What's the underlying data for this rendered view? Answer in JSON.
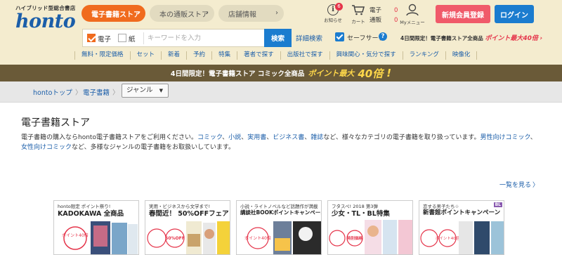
{
  "header": {
    "logo_tagline": "ハイブリッド型総合書店",
    "logo_word": "honto",
    "nav": [
      {
        "label": "電子書籍ストア"
      },
      {
        "label": "本の通販ストア"
      },
      {
        "label": "店舗情報"
      }
    ],
    "info": {
      "label": "お知らせ",
      "badge": "6"
    },
    "cart": {
      "label": "カート",
      "ebook_label": "電子",
      "ebook_count": "0",
      "paper_label": "通販",
      "paper_count": "0"
    },
    "my_menu_label": "Myメニュー",
    "register_label": "新規会員登録",
    "login_label": "ログイン"
  },
  "search": {
    "ebook_label": "電子",
    "paper_label": "紙",
    "placeholder": "キーワードを入力",
    "button_label": "検索",
    "advanced_label": "詳細検索",
    "safe_search_label": "セーフサーチ",
    "help_label": "?",
    "promo_text": "4日間限定！電子書籍ストア全商品",
    "promo_highlight": "ポイント最大40倍"
  },
  "subnav": [
    "無料・限定価格",
    "セット",
    "新着",
    "予約",
    "特集",
    "著者で探す",
    "出版社で探す",
    "興味関心・気分で探す",
    "ランキング",
    "映像化"
  ],
  "banner": {
    "text": "4日間限定！電子書籍ストア コミック全商品",
    "highlight": "ポイント最大",
    "big": "40倍",
    "end": "!"
  },
  "breadcrumb": {
    "home": "hontoトップ",
    "ebook": "電子書籍",
    "genre_select": "ジャンル",
    "sep": "〉"
  },
  "main": {
    "title": "電子書籍ストア",
    "intro": {
      "p1": "電子書籍の購入ならhonto電子書籍ストアをご利用ください。",
      "l1": "コミック",
      "c1": "、",
      "l2": "小説",
      "c2": "、",
      "l3": "実用書",
      "c3": "、",
      "l4": "ビジネス書",
      "c4": "、",
      "l5": "雑誌",
      "p2": "など、様々なカテゴリの電子書籍を取り扱っています。",
      "l6": "男性向けコミック",
      "c5": "、",
      "l7": "女性向けコミック",
      "p3": "など、多様なジャンルの電子書籍をお取扱いしています。"
    },
    "see_all_label": "一覧を見る",
    "see_all_chev": "〉"
  },
  "cards": [
    {
      "sub": "honto限定 ポイント祭り!",
      "title": "KADOKAWA 全商品",
      "badge": "ポイント40倍"
    },
    {
      "sub": "実用・ビジネスから文学まで!",
      "title": "春間近！ 50%OFFフェア",
      "badge": "50%OFF"
    },
    {
      "sub": "小説・ライトノベルなど話題作が満載",
      "title": "講談社BOOKポイントキャンペーン",
      "badge": "ポイント40倍"
    },
    {
      "sub": "フタスペ! 2018 第3弾",
      "title": "少女・TL・BL特集",
      "badge": "特別価格"
    },
    {
      "sub": "恋する男子たち☆",
      "title": "新書館ポイントキャンペーン",
      "badge": "ポイント40倍",
      "tag": "BL"
    }
  ],
  "colors": {
    "header_bg": "#f4eccf",
    "brand_blue": "#1b5ea9",
    "accent_orange": "#f06b1e",
    "register_pink": "#f05a6a",
    "login_blue": "#1b7ccf",
    "banner_bg": "#6a5a38"
  }
}
